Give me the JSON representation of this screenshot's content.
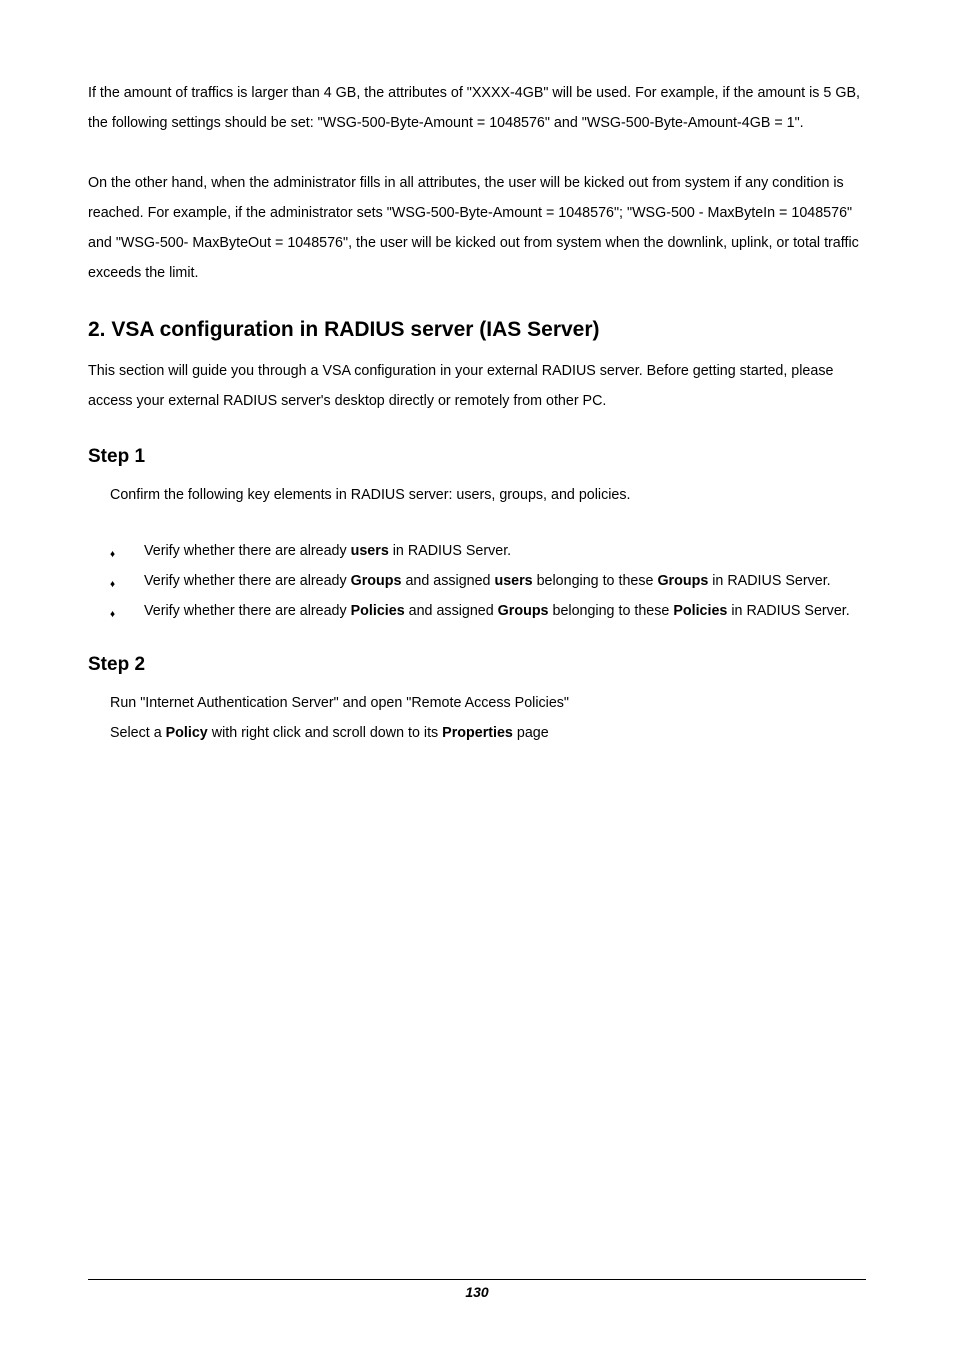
{
  "para1": "If the amount of traffics is larger than 4 GB, the attributes of \"XXXX-4GB\" will be used. For example, if the amount is 5 GB, the following settings should be set: \"WSG-500-Byte-Amount = 1048576\" and \"WSG-500-Byte-Amount-4GB = 1\".",
  "para2": "On the other hand, when the administrator fills in all attributes, the user will be kicked out from system if any condition is reached. For example, if the administrator sets \"WSG-500-Byte-Amount = 1048576\"; \"WSG-500 - MaxByteIn = 1048576\" and \"WSG-500- MaxByteOut = 1048576\", the user will be kicked out from system when the downlink, uplink, or total traffic exceeds the limit.",
  "heading2": "2. VSA configuration in RADIUS server (IAS Server)",
  "para3": "This section will guide you through a VSA configuration in your external RADIUS server. Before getting started, please access your external RADIUS server's desktop directly or remotely from other PC.",
  "step1_title": "Step 1",
  "step1_intro": "Confirm the following key elements in RADIUS server: users, groups, and policies.",
  "bullets": {
    "b1_pre": "Verify whether there are already ",
    "b1_bold": "users",
    "b1_post": " in RADIUS Server.",
    "b2_pre": "Verify whether there are already ",
    "b2_bold1": "Groups",
    "b2_mid1": " and assigned ",
    "b2_bold2": "users",
    "b2_mid2": " belonging to these ",
    "b2_bold3": "Groups",
    "b2_post": " in RADIUS Server.",
    "b3_pre": "Verify whether there are already ",
    "b3_bold1": "Policies",
    "b3_mid1": " and assigned ",
    "b3_bold2": "Groups",
    "b3_mid2": " belonging to these ",
    "b3_bold3": "Policies",
    "b3_post": " in RADIUS Server."
  },
  "step2_title": "Step 2",
  "step2_line1": "Run \"Internet Authentication Server\" and open \"Remote Access Policies\"",
  "step2_line2_pre": "Select a ",
  "step2_line2_bold1": "Policy",
  "step2_line2_mid": " with right click and scroll down to its ",
  "step2_line2_bold2": "Properties",
  "step2_line2_post": " page",
  "page_number": "130"
}
